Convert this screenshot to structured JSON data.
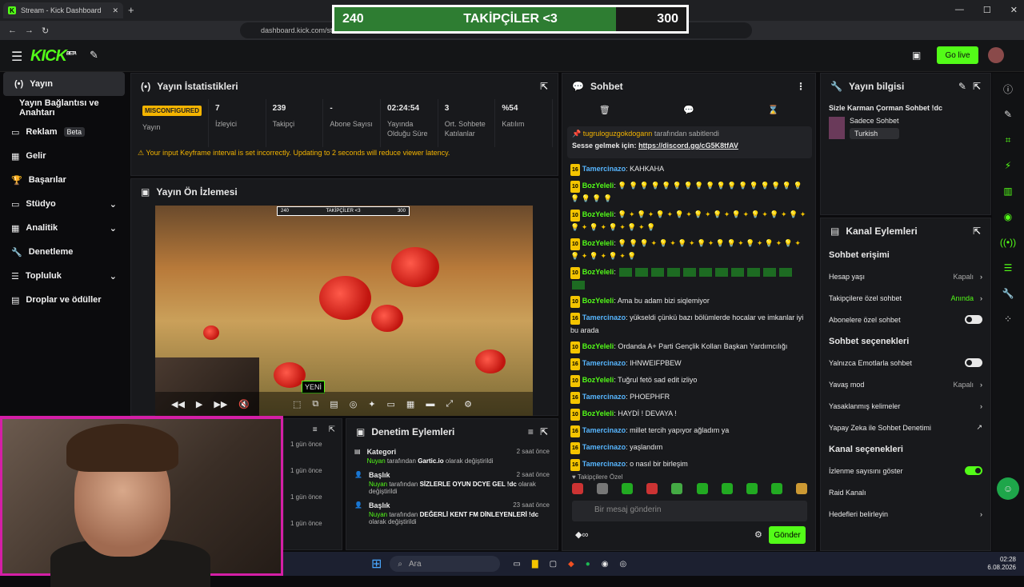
{
  "browser": {
    "tab_title": "Stream - Kick Dashboard",
    "url": "dashboard.kick.com/st"
  },
  "overlay": {
    "left": "240",
    "center": "TAKİPÇİLER <3",
    "right": "300",
    "fill": 0.8
  },
  "nav": {
    "logo": "KICK",
    "logo_sup": "BETA",
    "go_live": "Go live"
  },
  "sidebar": {
    "items": [
      {
        "label": "Yayın"
      },
      {
        "label": "Yayın Bağlantısı ve Anahtarı"
      },
      {
        "label": "Reklam",
        "badge": "Beta"
      },
      {
        "label": "Gelir"
      },
      {
        "label": "Başarılar"
      },
      {
        "label": "Stüdyo"
      },
      {
        "label": "Analitik"
      },
      {
        "label": "Denetleme"
      },
      {
        "label": "Topluluk"
      },
      {
        "label": "Droplar ve ödüller"
      }
    ]
  },
  "stats": {
    "title": "Yayın İstatistikleri",
    "items": [
      {
        "value": "MISCONFIGURED",
        "label": "Yayın"
      },
      {
        "value": "7",
        "label": "İzleyici"
      },
      {
        "value": "239",
        "label": "Takipçi"
      },
      {
        "value": "-",
        "label": "Abone Sayısı"
      },
      {
        "value": "02:24:54",
        "label": "Yayında Olduğu Süre"
      },
      {
        "value": "3",
        "label": "Ort. Sohbete Katılanlar"
      },
      {
        "value": "%54",
        "label": "Katılım"
      }
    ],
    "warning": "Your input Keyframe interval is set incorrectly. Updating to 2 seconds will reduce viewer latency."
  },
  "preview": {
    "title": "Yayın Ön İzlemesi",
    "new_label": "YENİ",
    "mini_left": "240",
    "mini_center": "TAKİPÇİLER <3",
    "mini_right": "300"
  },
  "chat": {
    "title": "Sohbet",
    "pinned_user": "tugruloguzgokdogann",
    "pinned_by": "tarafından sabitlendi",
    "pinned_text": "Sesse gelmek için:",
    "pinned_link": "https://discord.gg/cG5K8tfAV",
    "placeholder": "Bir mesaj gönderin",
    "send": "Gönder",
    "followers_label": "Takipçilere Özel",
    "messages": [
      {
        "badge": "16",
        "user": "Tamercinazo",
        "cls": "u1",
        "text": "KAHKAHA"
      },
      {
        "badge": "10",
        "user": "BozYeleli",
        "cls": "u2",
        "text": "💡 💡 💡 💡 💡 💡 💡 💡 💡 💡 💡 💡 💡 💡 💡 💡 💡 💡 💡 💡 💡"
      },
      {
        "badge": "10",
        "user": "BozYeleli",
        "cls": "u2",
        "text": "💡 ✦ 💡 ✦ 💡 ✦ 💡 ✦ 💡 ✦ 💡 ✦ 💡 ✦ 💡 ✦ 💡 ✦ 💡 ✦ 💡 ✦ 💡 ✦ 💡 ✦ 💡 ✦ 💡"
      },
      {
        "badge": "10",
        "user": "BozYeleli",
        "cls": "u2",
        "text": "💡 💡 💡 ✦ 💡 ✦ 💡 ✦ 💡 ✦ 💡 💡 ✦ 💡 ✦ 💡 ✦ 💡 ✦ 💡 ✦ 💡 ✦ 💡 ✦ 💡"
      },
      {
        "badge": "10",
        "user": "BozYeleli",
        "cls": "u2",
        "text": "EMOTES"
      },
      {
        "badge": "10",
        "user": "BozYeleli",
        "cls": "u2",
        "text": "Ama bu adam bizi siqlemiyor"
      },
      {
        "badge": "16",
        "user": "Tamercinazo",
        "cls": "u1",
        "text": "yükseldi çünkü bazı bölümlerde hocalar ve imkanlar iyi bu arada"
      },
      {
        "badge": "10",
        "user": "BozYeleli",
        "cls": "u2",
        "text": "Ordanda A+ Parti Gençlik Kolları Başkan Yardımcılığı"
      },
      {
        "badge": "16",
        "user": "Tamercinazo",
        "cls": "u1",
        "text": "IHNWEIFPBEW"
      },
      {
        "badge": "10",
        "user": "BozYeleli",
        "cls": "u2",
        "text": "Tuğrul fetö sad edit izliyo"
      },
      {
        "badge": "16",
        "user": "Tamercinazo",
        "cls": "u1",
        "text": "PHOEPHFR"
      },
      {
        "badge": "10",
        "user": "BozYeleli",
        "cls": "u2",
        "text": "HAYDİ ! DEVAYA !"
      },
      {
        "badge": "16",
        "user": "Tamercinazo",
        "cls": "u1",
        "text": "millet tercih yapıyor ağladım ya"
      },
      {
        "badge": "16",
        "user": "Tamercinazo",
        "cls": "u1",
        "text": "yaşlandım"
      },
      {
        "badge": "16",
        "user": "Tamercinazo",
        "cls": "u1",
        "text": "o nasıl bir birleşim"
      }
    ]
  },
  "info": {
    "title": "Yayın bilgisi",
    "stream_title": "Sizle Karman Çorman Sohbet !dc",
    "category": "Sadece Sohbet",
    "tag": "Turkish"
  },
  "channel": {
    "title": "Kanal Eylemleri",
    "sections": [
      {
        "heading": "Sohbet erişimi",
        "rows": [
          {
            "label": "Hesap yaşı",
            "value": "Kapalı",
            "kind": "chev"
          },
          {
            "label": "Takipçilere özel sohbet",
            "value": "Anında",
            "kind": "chev-green"
          },
          {
            "label": "Abonelere özel sohbet",
            "value": "",
            "kind": "toggle"
          }
        ]
      },
      {
        "heading": "Sohbet seçenekleri",
        "rows": [
          {
            "label": "Yalnızca Emotlarla sohbet",
            "value": "",
            "kind": "toggle"
          },
          {
            "label": "Yavaş mod",
            "value": "Kapalı",
            "kind": "chev"
          },
          {
            "label": "Yasaklanmış kelimeler",
            "value": "",
            "kind": "chev"
          },
          {
            "label": "Yapay Zeka ile Sohbet Denetimi",
            "value": "",
            "kind": "ext"
          }
        ]
      },
      {
        "heading": "Kanal seçenekleri",
        "rows": [
          {
            "label": "İzlenme sayısını göster",
            "value": "",
            "kind": "toggle-on"
          },
          {
            "label": "Raid Kanalı",
            "value": "",
            "kind": "none"
          },
          {
            "label": "Hedefleri belirleyin",
            "value": "",
            "kind": "chev"
          }
        ]
      }
    ]
  },
  "moderation": {
    "title": "Denetim Eylemleri",
    "times": [
      "1 gün önce",
      "1 gün önce",
      "1 gün önce",
      "1 gün önce"
    ],
    "items": [
      {
        "type": "Kategori",
        "time": "2 saat önce",
        "user": "Nuyan",
        "mid": "tarafından",
        "value": "Gartic.io",
        "end": "olarak değiştirildi"
      },
      {
        "type": "Başlık",
        "time": "2 saat önce",
        "user": "Nuyan",
        "mid": "tarafından",
        "value": "SİZLERLE OYUN DCYE GEL !dc",
        "end": "olarak değiştirildi"
      },
      {
        "type": "Başlık",
        "time": "23 saat önce",
        "user": "Nuyan",
        "mid": "tarafından",
        "value": "DEĞERLİ KENT FM DİNLEYENLERİ !dc",
        "end": "olarak değiştirildi"
      }
    ]
  },
  "taskbar": {
    "search": "Ara",
    "time": "02:28",
    "date": "6.08.2026"
  }
}
